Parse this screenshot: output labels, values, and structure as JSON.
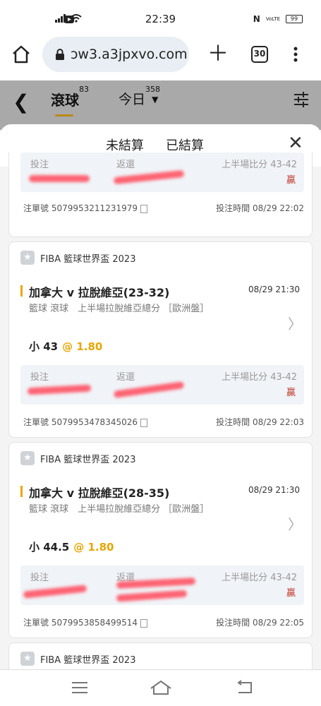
{
  "status": {
    "time": "22:39",
    "battery": "99"
  },
  "browser": {
    "url": "ɔw3.a3jpxvo.com",
    "tab_count": "30"
  },
  "header": {
    "tabs": [
      {
        "label": "滾球",
        "count": "83"
      },
      {
        "label": "今日",
        "count": "358"
      }
    ]
  },
  "sheet": {
    "tabs": [
      "未結算",
      "已結算"
    ]
  },
  "labels": {
    "stake": "投注",
    "return": "返還",
    "halftime": "上半場比分 43-42",
    "result": "贏",
    "ticket_no": "注單號",
    "bet_time": "投注時間"
  },
  "partial_card": {
    "ticket": "5079953211231979",
    "time": "08/29 22:02"
  },
  "bets": [
    {
      "league": "FIBA 籃球世界盃 2023",
      "match": "加拿大 v 拉脫維亞(23-32)",
      "match_time": "08/29 21:30",
      "market": "籃球 滾球　上半場拉脫維亞總分 ［歐洲盤］",
      "pick": "小 43",
      "odds": "@ 1.80",
      "ticket": "5079953478345026",
      "time": "08/29 22:03"
    },
    {
      "league": "FIBA 籃球世界盃 2023",
      "match": "加拿大 v 拉脫維亞(28-35)",
      "match_time": "08/29 21:30",
      "market": "籃球 滾球　上半場拉脫維亞總分 ［歐洲盤］",
      "pick": "小 44.5",
      "odds": "@ 1.80",
      "ticket": "5079953858499514",
      "time": "08/29 22:05"
    },
    {
      "league": "FIBA 籃球世界盃 2023"
    }
  ]
}
